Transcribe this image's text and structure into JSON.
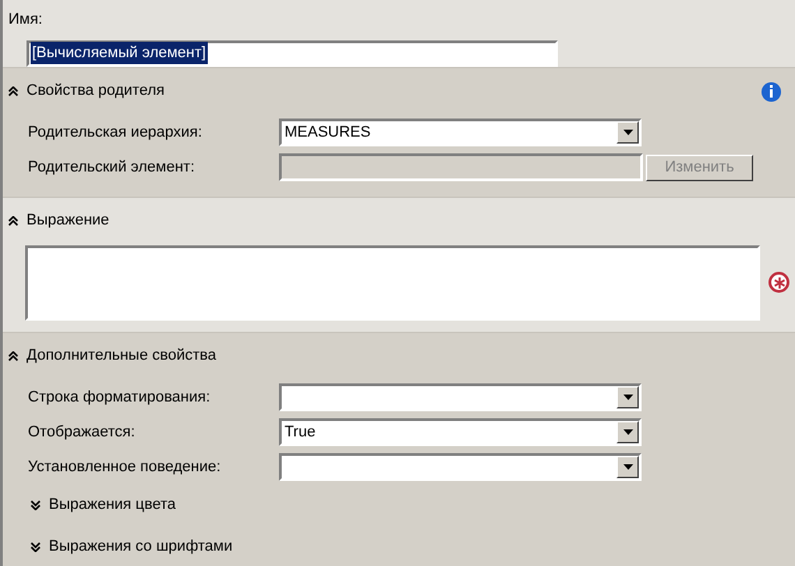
{
  "name_field": {
    "label": "Имя:",
    "value": "[Вычисляемый элемент]",
    "selected": true
  },
  "sections": [
    {
      "title": "Свойства родителя",
      "expanded": true,
      "info": true,
      "rows": [
        {
          "kind": "dropdown",
          "label": "Родительская иерархия:",
          "value": "MEASURES",
          "disabled": false
        },
        {
          "kind": "picker",
          "label": "Родительский элемент:",
          "value": "",
          "disabled": true,
          "button": "Изменить"
        }
      ]
    },
    {
      "title": "Выражение",
      "expanded": true,
      "info": false,
      "rows": [
        {
          "kind": "textarea",
          "required": true
        }
      ]
    },
    {
      "title": "Дополнительные свойства",
      "expanded": true,
      "info": false,
      "rows": [
        {
          "kind": "dropdown",
          "label": "Строка форматирования:",
          "value": "",
          "disabled": false
        },
        {
          "kind": "dropdown",
          "label": "Отображается:",
          "value": "True",
          "disabled": false
        },
        {
          "kind": "dropdown",
          "label": "Установленное поведение:",
          "value": "",
          "disabled": false
        },
        {
          "kind": "subsection",
          "title": "Выражения цвета",
          "expanded": false
        },
        {
          "kind": "subsection",
          "title": "Выражения со шрифтами",
          "expanded": false
        }
      ]
    }
  ]
}
